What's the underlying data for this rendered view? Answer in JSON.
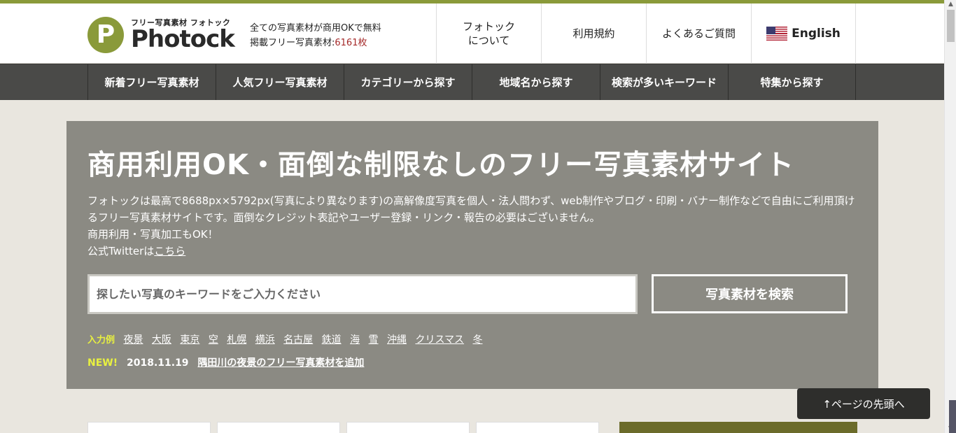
{
  "brand": {
    "logo_letter": "P",
    "logo_sub": "フリー写真素材 フォトック",
    "logo_name": "Photock",
    "tagline_line1": "全ての写真素材が商用OKで無料",
    "tagline_line2_prefix": "掲載フリー写真素材:",
    "tagline_count": "6161枚",
    "accent_color": "#8a9a3a"
  },
  "header_nav": [
    {
      "label": "フォトック について"
    },
    {
      "label": "利用規約"
    },
    {
      "label": "よくあるご質問"
    },
    {
      "label": "English",
      "icon": "us-flag-icon"
    }
  ],
  "global_nav": [
    {
      "label": "新着フリー写真素材"
    },
    {
      "label": "人気フリー写真素材"
    },
    {
      "label": "カテゴリーから探す"
    },
    {
      "label": "地域名から探す"
    },
    {
      "label": "検索が多いキーワード"
    },
    {
      "label": "特集から探す"
    }
  ],
  "hero": {
    "title": "商用利用OK・面倒な制限なしのフリー写真素材サイト",
    "desc_line1": "フォトックは最高で8688px×5792px(写真により異なります)の高解像度写真を個人・法人問わず、web制作やブログ・印刷・バナー制作などで自由にご利用頂けるフリー写真素材サイトです。面倒なクレジット表記やユーザー登録・リンク・報告の必要はございません。",
    "desc_line2": "商用利用・写真加工もOK！",
    "desc_line3_prefix": "公式Twitterは",
    "desc_line3_link": "こちら",
    "search_placeholder": "探したい写真のキーワードをご入力ください",
    "search_button": "写真素材を検索",
    "examples_label": "入力例",
    "examples": [
      "夜景",
      "大阪",
      "東京",
      "空",
      "札幌",
      "横浜",
      "名古屋",
      "鉄道",
      "海",
      "雪",
      "沖縄",
      "クリスマス",
      "冬"
    ],
    "news_badge": "NEW!",
    "news_date": "2018.11.19",
    "news_link": "隅田川の夜景のフリー写真素材を追加"
  },
  "to_top": "↑ページの先頭へ"
}
